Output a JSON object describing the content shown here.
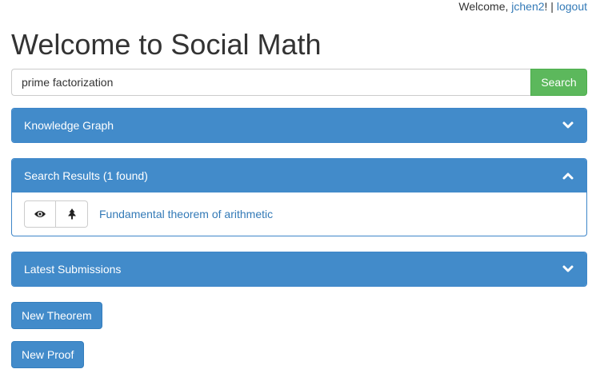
{
  "header": {
    "welcome_prefix": "Welcome, ",
    "username": "jchen2",
    "welcome_suffix": "! | ",
    "logout_label": "logout"
  },
  "page_title": "Welcome to Social Math",
  "search": {
    "value": "prime factorization",
    "button_label": "Search"
  },
  "panels": {
    "knowledge_graph": {
      "title": "Knowledge Graph",
      "state": "collapsed",
      "chevron_icon": "chevron-down-icon"
    },
    "search_results": {
      "title": "Search Results (1 found)",
      "state": "expanded",
      "chevron_icon": "chevron-up-icon",
      "results": [
        {
          "view_icon": "eye-icon",
          "tree_icon": "tree-icon",
          "label": "Fundamental theorem of arithmetic"
        }
      ]
    },
    "latest_submissions": {
      "title": "Latest Submissions",
      "state": "collapsed",
      "chevron_icon": "chevron-down-icon"
    }
  },
  "actions": {
    "new_theorem_label": "New Theorem",
    "new_proof_label": "New Proof"
  },
  "colors": {
    "panel_primary": "#428bca",
    "search_button": "#5cb85c",
    "link": "#337ab7"
  }
}
